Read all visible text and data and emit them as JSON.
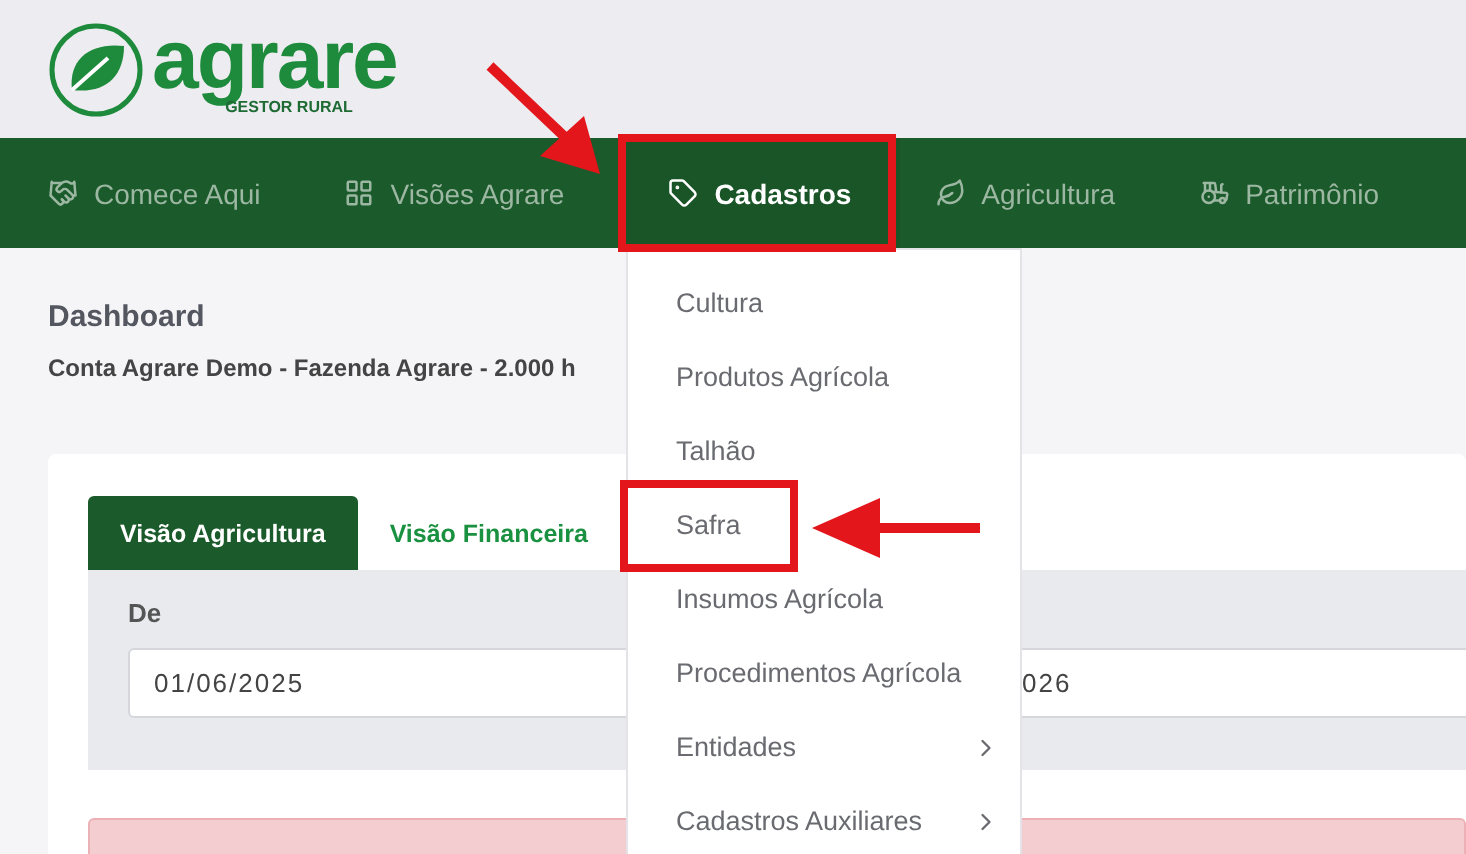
{
  "logo": {
    "name": "agrare",
    "tagline": "GESTOR RURAL"
  },
  "nav": [
    {
      "label": "Comece Aqui",
      "selected": false
    },
    {
      "label": "Visões Agrare",
      "selected": false
    },
    {
      "label": "Cadastros",
      "selected": true
    },
    {
      "label": "Agricultura",
      "selected": false
    },
    {
      "label": "Patrimônio",
      "selected": false
    }
  ],
  "page": {
    "title": "Dashboard",
    "subtitle": "Conta Agrare Demo - Fazenda Agrare - 2.000 h"
  },
  "tabs": [
    {
      "label": "Visão Agricultura",
      "selected": true
    },
    {
      "label": "Visão Financeira",
      "selected": false
    }
  ],
  "filters": {
    "from_label": "De",
    "from_value": "01/06/2025",
    "to_value": "026"
  },
  "dropdown": [
    {
      "label": "Cultura",
      "submenu": false,
      "highlighted": false
    },
    {
      "label": "Produtos Agrícola",
      "submenu": false,
      "highlighted": false
    },
    {
      "label": "Talhão",
      "submenu": false,
      "highlighted": false
    },
    {
      "label": "Safra",
      "submenu": false,
      "highlighted": true
    },
    {
      "label": "Insumos Agrícola",
      "submenu": false,
      "highlighted": false
    },
    {
      "label": "Procedimentos Agrícola",
      "submenu": false,
      "highlighted": false
    },
    {
      "label": "Entidades",
      "submenu": true,
      "highlighted": false
    },
    {
      "label": "Cadastros Auxiliares",
      "submenu": true,
      "highlighted": false
    }
  ]
}
